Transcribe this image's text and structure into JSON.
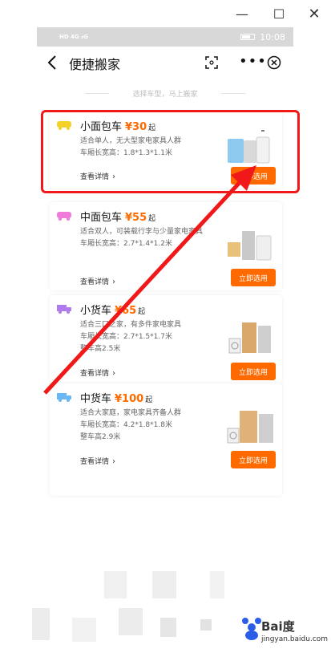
{
  "window": {
    "minimize": "—",
    "maximize": "☐",
    "close": "✕"
  },
  "statusbar": {
    "network": "HD 4G ₄G",
    "time": "10:08"
  },
  "navbar": {
    "title": "便捷搬家",
    "more": "•••"
  },
  "section_hint": "选择车型，马上搬家",
  "cards": [
    {
      "name": "小面包车",
      "price": "¥30",
      "suffix": "起",
      "desc": [
        "适合单人，无大型家电家具人群",
        "车厢长宽高：1.8*1.3*1.1米"
      ],
      "detail": "查看详情",
      "button": "立即选用",
      "icon_color": "#f5d22a"
    },
    {
      "name": "中面包车",
      "price": "¥55",
      "suffix": "起",
      "desc": [
        "适合双人，可装载行李与少量家电家具",
        "车厢长宽高：2.7*1.4*1.2米"
      ],
      "detail": "查看详情",
      "button": "立即选用",
      "icon_color": "#f07ad8"
    },
    {
      "name": "小货车",
      "price": "¥65",
      "suffix": "起",
      "desc": [
        "适合三口之家，有多件家电家具",
        "车厢长宽高：2.7*1.5*1.7米",
        "整车高2.5米"
      ],
      "detail": "查看详情",
      "button": "立即选用",
      "icon_color": "#b07aef"
    },
    {
      "name": "中货车",
      "price": "¥100",
      "suffix": "起",
      "desc": [
        "适合大家庭，家电家具齐备人群",
        "车厢长宽高：4.2*1.8*1.8米",
        "整车高2.9米"
      ],
      "detail": "查看详情",
      "button": "立即选用",
      "icon_color": "#6ab7f5"
    }
  ],
  "colors": {
    "accent": "#ff6a00",
    "annotation": "#f01818"
  },
  "watermark": {
    "brand": "Bai度",
    "url": "jingyan.baidu.com"
  }
}
